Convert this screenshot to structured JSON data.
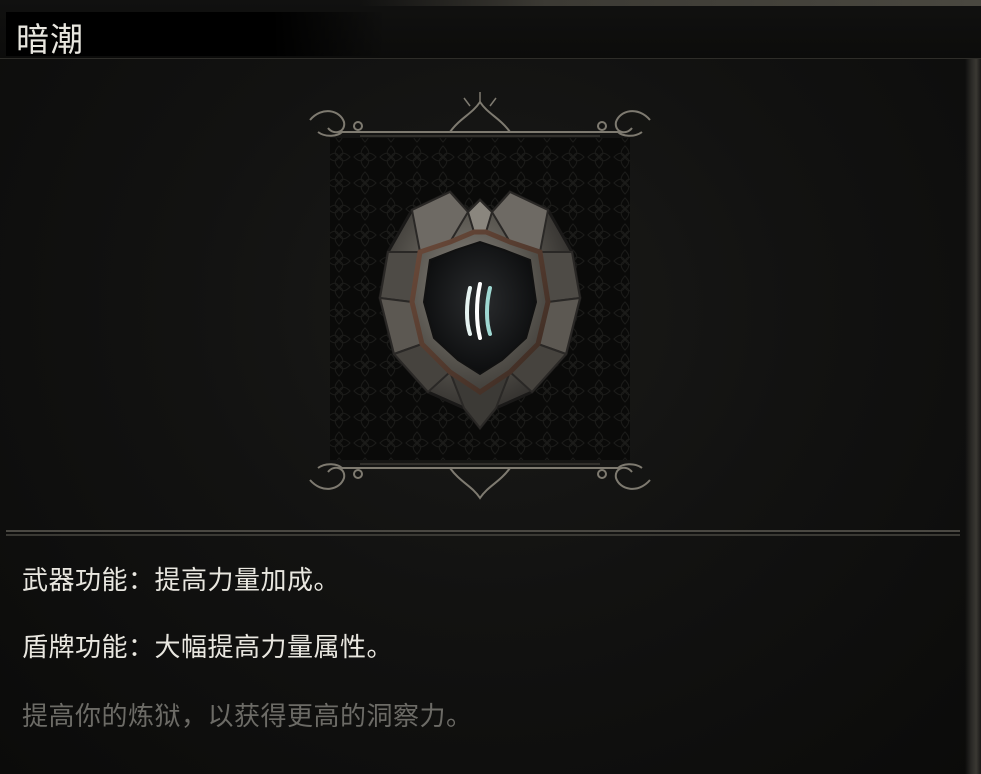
{
  "item": {
    "name": "暗潮",
    "icon": "dark-tide-rune-icon",
    "accent_color": "#9fd8d2"
  },
  "description": {
    "weapon_effect": "武器功能：提高力量加成。",
    "shield_effect": "盾牌功能：大幅提高力量属性。",
    "flavor": "提高你的炼狱，以获得更高的洞察力。"
  },
  "colors": {
    "background": "#0d0d0c",
    "primary_text": "#e9e7e0",
    "secondary_text": "#6c6b66",
    "frame": "#7e7a70"
  }
}
